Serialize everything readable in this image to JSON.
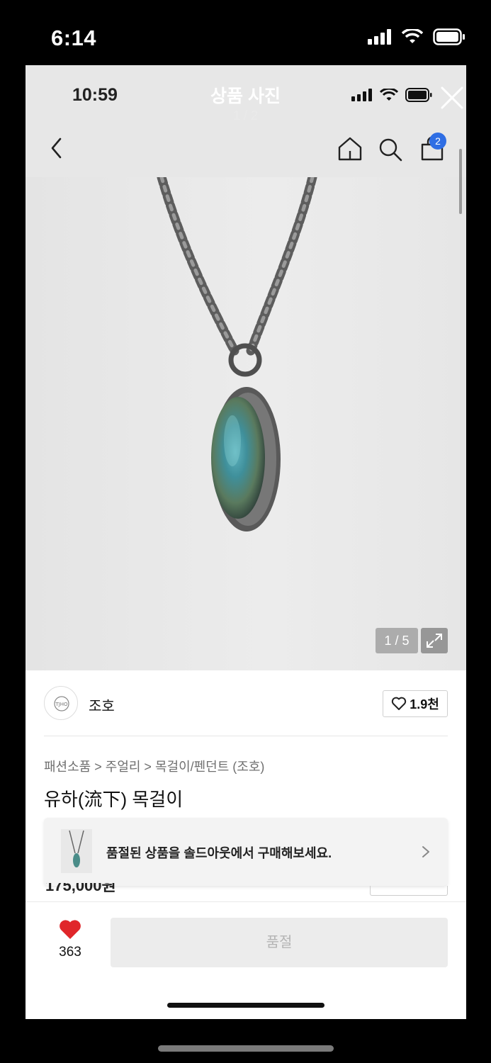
{
  "outer_status": {
    "time": "6:14"
  },
  "viewer": {
    "title": "상품 사진",
    "counter": "1 / 2"
  },
  "inner_status": {
    "time": "10:59"
  },
  "nav": {
    "cart_count": "2"
  },
  "image": {
    "counter": "1 / 5"
  },
  "brand": {
    "logo_text": "TJHO",
    "name": "조호",
    "likes": "1.9천"
  },
  "breadcrumb": "패션소품 > 주얼리 > 목걸이/펜던트 (조호)",
  "product": {
    "title": "유하(流下) 목걸이"
  },
  "soldout": {
    "message": "품절된 상품을 솔드아웃에서 구매해보세요."
  },
  "price_partial": "175,000원",
  "bottom": {
    "like_count": "363",
    "buy_label": "품절"
  },
  "colors": {
    "badge": "#2f6ee4",
    "heart": "#e0262a",
    "button_bg": "#ececec"
  }
}
